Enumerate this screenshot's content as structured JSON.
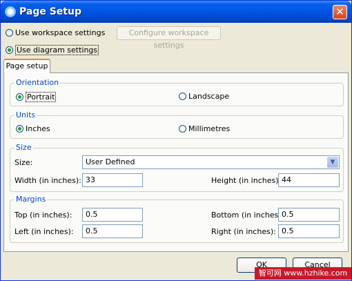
{
  "window": {
    "title": "Page Setup",
    "icon": "eclipse-page-setup-icon",
    "close_glyph": "✕"
  },
  "options": {
    "use_workspace": "Use workspace settings",
    "configure_workspace": "Configure workspace settings",
    "use_diagram": "Use diagram settings",
    "selected": "use_diagram"
  },
  "tab": {
    "label": "Page setup"
  },
  "orientation": {
    "heading": "Orientation",
    "portrait": "Portrait",
    "landscape": "Landscape",
    "selected": "portrait"
  },
  "units": {
    "heading": "Units",
    "inches": "Inches",
    "millimetres": "Millimetres",
    "selected": "inches"
  },
  "size": {
    "heading": "Size",
    "size_label": "Size:",
    "size_value": "User Defined",
    "width_label": "Width (in inches):",
    "width_value": "33",
    "height_label": "Height (in inches):",
    "height_value": "44"
  },
  "margins": {
    "heading": "Margins",
    "top_label": "Top (in inches):",
    "top_value": "0.5",
    "bottom_label": "Bottom (in inches):",
    "bottom_value": "0.5",
    "left_label": "Left (in inches):",
    "left_value": "0.5",
    "right_label": "Right (in inches):",
    "right_value": "0.5"
  },
  "buttons": {
    "ok": "OK",
    "cancel": "Cancel"
  },
  "watermark": "智可网 www.hzhike.com",
  "colors": {
    "title_bar": "#0055e5",
    "group_heading": "#0046d5",
    "radio_selected": "#21a121",
    "dialog_bg": "#ece9d8"
  }
}
